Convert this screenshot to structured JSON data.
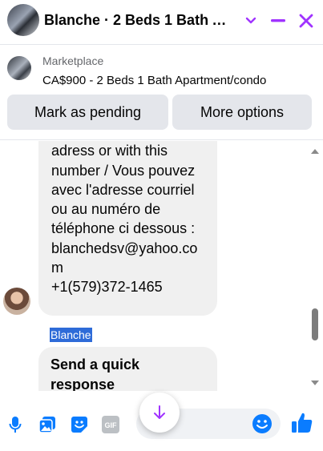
{
  "header": {
    "title": "Blanche · 2 Beds 1 Bath Apartment/condo",
    "icons": [
      "chevron-down-icon",
      "minimize-icon",
      "close-icon"
    ],
    "accent_color": "#a033ff"
  },
  "marketplace": {
    "label": "Marketplace",
    "listing": "CA$900 - 2 Beds 1 Bath Apartment/condo",
    "mark_pending_label": "Mark as pending",
    "more_options_label": "More options"
  },
  "conversation": {
    "message1_lines": "anytime with this mail\nadress or with this\nnumber / Vous pouvez\navec l'adresse courriel\nou au numéro de\ntéléphone ci dessous :\nblanchedsv@yahoo.co\nm\n+1(579)372-1465",
    "sender_name": "Blanche",
    "message2_lines": "Send a quick\nresponse"
  },
  "composer": {
    "icons": [
      "microphone-icon",
      "photo-icon",
      "sticker-icon",
      "gif-icon",
      "emoji-icon",
      "thumbs-up-icon"
    ],
    "gif_label": "GIF",
    "icon_color": "#0a7cff"
  }
}
